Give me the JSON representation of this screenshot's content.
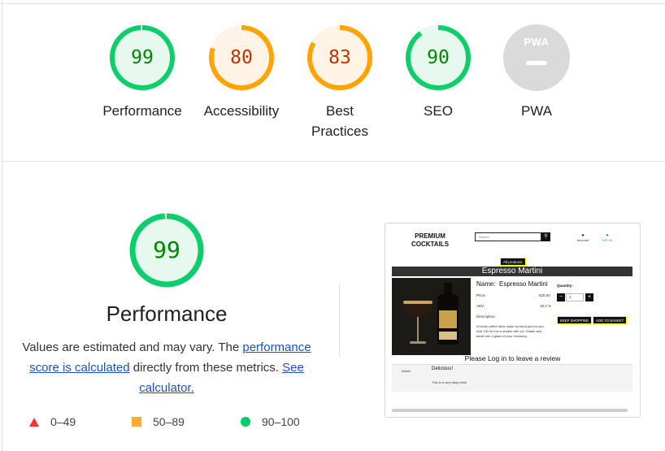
{
  "gauges": [
    {
      "score": "99",
      "label": "Performance",
      "color": "#0cce6b",
      "text_color": "#008800",
      "bg": "#e7f8ee",
      "fraction": 0.99
    },
    {
      "score": "80",
      "label": "Accessibility",
      "color": "#ffa400",
      "text_color": "#c33300",
      "bg": "#fff4e5",
      "fraction": 0.8
    },
    {
      "score": "83",
      "label": "Best Practices",
      "color": "#ffa400",
      "text_color": "#c33300",
      "bg": "#fff4e5",
      "fraction": 0.83
    },
    {
      "score": "90",
      "label": "SEO",
      "color": "#0cce6b",
      "text_color": "#008800",
      "bg": "#e7f8ee",
      "fraction": 0.9
    },
    {
      "score": "",
      "label": "PWA",
      "badge": "PWA",
      "color": "#dadada"
    }
  ],
  "performance": {
    "score": "99",
    "fraction": 0.99,
    "title": "Performance",
    "note_prefix": "Values are estimated and may vary. The ",
    "note_link1": "performance score is calculated",
    "note_middle": " directly from these metrics. ",
    "note_link2": "See calculator."
  },
  "legend": [
    {
      "range": "0–49",
      "shape": "triangle",
      "color": "#ff3333"
    },
    {
      "range": "50–89",
      "shape": "square",
      "color": "#ffaa33"
    },
    {
      "range": "90–100",
      "shape": "circle",
      "color": "#00cc66"
    }
  ],
  "screenshot": {
    "brand": "PREMIUM COCKTAILS",
    "search_placeholder": "Search",
    "search_icon": "magnifier-icon",
    "account": "Account",
    "cart": "€25.99",
    "all_products": "All products",
    "product_title": "Espresso Martini",
    "name_label": "Name:",
    "name_value": "Espresso Martini",
    "price_label": "Price:",
    "price_value": "€25.00",
    "abv_label": "ABV:",
    "abv_value": "18.2 %",
    "quantity_label": "Quantity:",
    "quantity_value": "1",
    "minus": "−",
    "plus": "+",
    "description_label": "Description:",
    "description_text": "A lovely coffee drink made by hand just for you. Add 150 ml into a shaker with ice. Shake and strain into a glass of your choosing.",
    "keep_shopping": "KEEP SHOPPING",
    "add_to_basket": "ADD TO BASKET",
    "login_prompt": "Please Log in to leave a review",
    "review_author": "Admin",
    "review_title": "Delicious!",
    "review_body": "This is a very tasty drink"
  }
}
